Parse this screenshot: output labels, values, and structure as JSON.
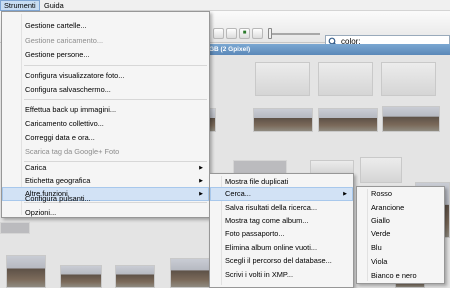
{
  "menubar": {
    "items": [
      "Strumenti",
      "Guida"
    ]
  },
  "search": {
    "value": "color:"
  },
  "group_header": "GB (2 Gpixel)",
  "strumenti_menu": {
    "items": [
      "Gestione cartelle...",
      "Gestione caricamento...",
      "Gestione persone...",
      "Configura visualizzatore foto...",
      "Configura salvaschermo...",
      "Effettua back up immagini...",
      "Caricamento collettivo...",
      "Correggi data e ora...",
      "Scarica tag da Google+ Foto",
      "Carica",
      "Etichetta geografica",
      "Altre funzioni",
      "Configura pulsanti...",
      "Opzioni..."
    ]
  },
  "altre_funzioni_menu": {
    "items": [
      "Mostra file duplicati",
      "Cerca...",
      "Salva risultati della ricerca...",
      "Mostra tag come album...",
      "Foto passaporto...",
      "Elimina album online vuoti...",
      "Scegli il percorso del database...",
      "Scrivi i volti in XMP..."
    ]
  },
  "cerca_menu": {
    "items": [
      "Rosso",
      "Arancione",
      "Giallo",
      "Verde",
      "Blu",
      "Viola",
      "Bianco e nero"
    ]
  },
  "icons": {
    "search": "search-icon",
    "submenu": "chevron-right-icon"
  },
  "colors": {
    "highlight": "#d2e2f5",
    "group_header": "#5b88b8",
    "disabled_text": "#8d8d8d"
  }
}
